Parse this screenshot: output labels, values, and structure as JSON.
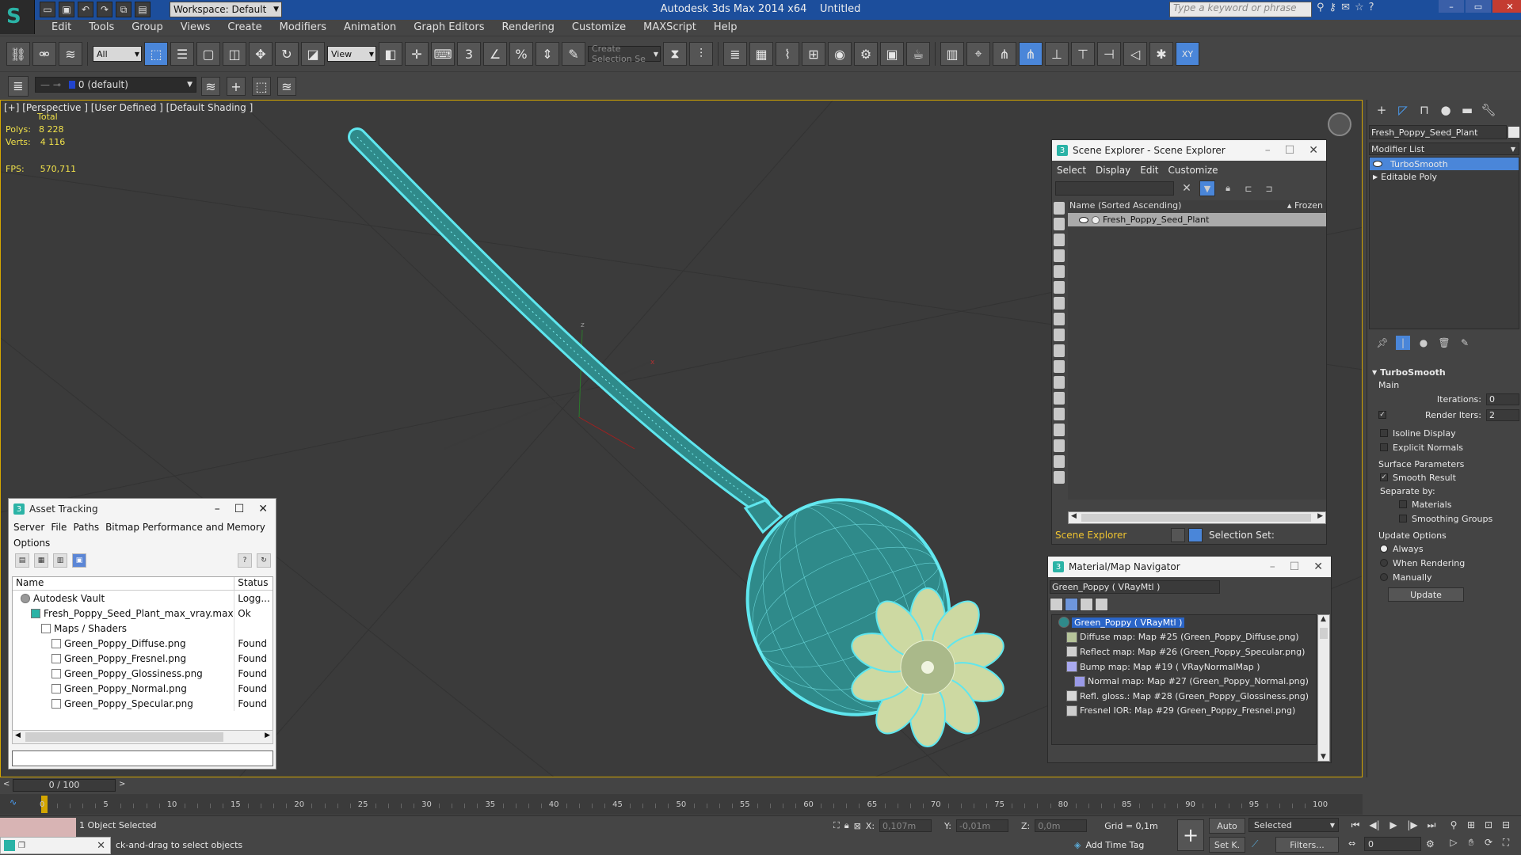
{
  "app": {
    "title": "Autodesk 3ds Max  2014 x64",
    "file": "Untitled",
    "workspace": "Workspace: Default",
    "search_placeholder": "Type a keyword or phrase"
  },
  "menu": [
    "Edit",
    "Tools",
    "Group",
    "Views",
    "Create",
    "Modifiers",
    "Animation",
    "Graph Editors",
    "Rendering",
    "Customize",
    "MAXScript",
    "Help"
  ],
  "toolbar": {
    "selection_filter": "All",
    "reference_coord": "View",
    "named_selection": "Create Selection Se",
    "layer": "0 (default)"
  },
  "viewport": {
    "label": "[+] [Perspective ] [User Defined ] [Default Shading ]",
    "stats": {
      "total_label": "Total",
      "polys_label": "Polys:",
      "polys": "8 228",
      "verts_label": "Verts:",
      "verts": "4 116",
      "fps_label": "FPS:",
      "fps": "570,711"
    },
    "colors": {
      "wire": "#5fe6ee",
      "body": "#2f8a8a",
      "background": "#3b3b3b"
    }
  },
  "asset_tracking": {
    "title": "Asset Tracking",
    "menu": [
      "Server",
      "File",
      "Paths",
      "Bitmap Performance and Memory"
    ],
    "menu2": "Options",
    "col_name": "Name",
    "col_status": "Status",
    "rows": [
      {
        "name": "Autodesk Vault",
        "status": "Logg...",
        "indent": 0,
        "icon": "vault"
      },
      {
        "name": "Fresh_Poppy_Seed_Plant_max_vray.max",
        "status": "Ok",
        "indent": 1,
        "icon": "max"
      },
      {
        "name": "Maps / Shaders",
        "status": "",
        "indent": 2,
        "icon": "folder"
      },
      {
        "name": "Green_Poppy_Diffuse.png",
        "status": "Found",
        "indent": 3,
        "icon": "image"
      },
      {
        "name": "Green_Poppy_Fresnel.png",
        "status": "Found",
        "indent": 3,
        "icon": "image"
      },
      {
        "name": "Green_Poppy_Glossiness.png",
        "status": "Found",
        "indent": 3,
        "icon": "image"
      },
      {
        "name": "Green_Poppy_Normal.png",
        "status": "Found",
        "indent": 3,
        "icon": "image"
      },
      {
        "name": "Green_Poppy_Specular.png",
        "status": "Found",
        "indent": 3,
        "icon": "image"
      }
    ]
  },
  "scene_explorer": {
    "title": "Scene Explorer - Scene Explorer",
    "menu": [
      "Select",
      "Display",
      "Edit",
      "Customize"
    ],
    "col_name": "Name (Sorted Ascending)",
    "col_frozen": "▴ Frozen",
    "object": "Fresh_Poppy_Seed_Plant",
    "footer_name": "Scene Explorer",
    "selection_set": "Selection Set:"
  },
  "material_nav": {
    "title": "Material/Map Navigator",
    "material": "Green_Poppy  ( VRayMtl )",
    "root": "Green_Poppy  ( VRayMtl )",
    "items": [
      {
        "label": "Diffuse map: Map #25 (Green_Poppy_Diffuse.png)",
        "swatch": "#b6c49a",
        "indent": 1
      },
      {
        "label": "Reflect map: Map #26 (Green_Poppy_Specular.png)",
        "swatch": "#cfcfcf",
        "indent": 1
      },
      {
        "label": "Bump map: Map #19  ( VRayNormalMap )",
        "swatch": "#a9a9f0",
        "indent": 1
      },
      {
        "label": "Normal map: Map #27 (Green_Poppy_Normal.png)",
        "swatch": "#9a9ae8",
        "indent": 2
      },
      {
        "label": "Refl. gloss.: Map #28 (Green_Poppy_Glossiness.png)",
        "swatch": "#d6d6d6",
        "indent": 1
      },
      {
        "label": "Fresnel IOR: Map #29 (Green_Poppy_Fresnel.png)",
        "swatch": "#cccccc",
        "indent": 1
      }
    ]
  },
  "command_panel": {
    "object_name": "Fresh_Poppy_Seed_Plant",
    "modifier_list": "Modifier List",
    "stack": [
      "TurboSmooth",
      "Editable Poly"
    ],
    "rollout_title": "TurboSmooth",
    "main": "Main",
    "iterations_label": "Iterations:",
    "iterations": "0",
    "render_iters_label": "Render Iters:",
    "render_iters": "2",
    "isoline": "Isoline Display",
    "explicit_normals": "Explicit Normals",
    "surface_params": "Surface Parameters",
    "smooth_result": "Smooth Result",
    "separate_by": "Separate by:",
    "materials": "Materials",
    "smoothing_groups": "Smoothing Groups",
    "update_options": "Update Options",
    "always": "Always",
    "when_rendering": "When Rendering",
    "manually": "Manually",
    "update_btn": "Update"
  },
  "timeline": {
    "frame": "0 / 100",
    "current": 0,
    "max": 100,
    "ticks": [
      0,
      5,
      10,
      15,
      20,
      25,
      30,
      35,
      40,
      45,
      50,
      55,
      60,
      65,
      70,
      75,
      80,
      85,
      90,
      95,
      100
    ]
  },
  "status": {
    "selected": "1 Object Selected",
    "prompt": "ck-and-drag to select objects",
    "x_label": "X:",
    "x": "0,107m",
    "y_label": "Y:",
    "y": "-0,01m",
    "z_label": "Z:",
    "z": "0,0m",
    "grid": "Grid = 0,1m",
    "add_time_tag": "Add Time Tag",
    "auto": "Auto",
    "set_key": "Set K.",
    "selected_drop": "Selected",
    "filters": "Filters...",
    "frame_field": "0"
  }
}
